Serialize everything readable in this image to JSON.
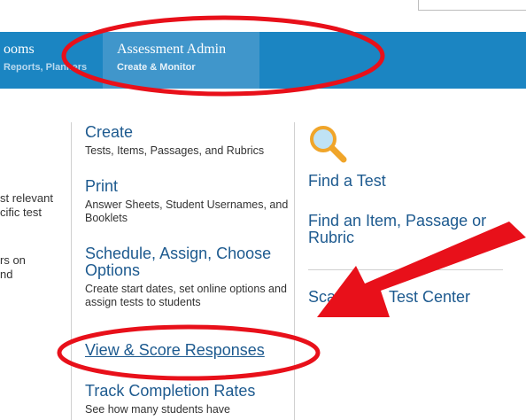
{
  "nav": {
    "tabs": [
      {
        "title": "ooms",
        "subtitle": "Reports, Planners"
      },
      {
        "title": "Assessment Admin",
        "subtitle": "Create & Monitor"
      }
    ]
  },
  "left_text": {
    "line1": "st relevant",
    "line2": "cific test",
    "line3": "rs on",
    "line4": "nd"
  },
  "middle": {
    "items": [
      {
        "title": "Create",
        "desc": "Tests, Items, Passages, and Rubrics"
      },
      {
        "title": "Print",
        "desc": "Answer Sheets, Student Usernames, and Booklets"
      },
      {
        "title": "Schedule, Assign, Choose Options",
        "desc": "Create start dates, set online options and assign tests to students"
      },
      {
        "title": "View & Score Responses",
        "desc": ""
      },
      {
        "title": "Track Completion Rates",
        "desc": "See how many students have"
      }
    ]
  },
  "right": {
    "icon": "magnifying-glass-icon",
    "links": [
      {
        "label": "Find a Test"
      },
      {
        "label": "Find an Item, Passage or Rubric"
      },
      {
        "label": "Scan"
      },
      {
        "label": "Test Center"
      }
    ]
  },
  "colors": {
    "nav_bg": "#1b85c2",
    "nav_active": "#4096cb",
    "link": "#1d5a8f",
    "annotation": "#e8101a"
  }
}
